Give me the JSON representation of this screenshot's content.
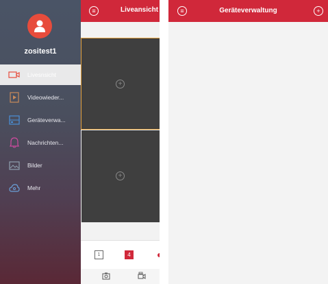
{
  "sidebar": {
    "username": "zositest1",
    "items": [
      {
        "label": "Livesnsicht",
        "icon": "camera-icon",
        "active": true
      },
      {
        "label": "Videowieder...",
        "icon": "video-playback-icon",
        "active": false
      },
      {
        "label": "Geräteverwa...",
        "icon": "device-icon",
        "active": false
      },
      {
        "label": "Nachrichten...",
        "icon": "bell-icon",
        "active": false
      },
      {
        "label": "Bilder",
        "icon": "image-icon",
        "active": false
      },
      {
        "label": "Mehr",
        "icon": "more-cloud-icon",
        "active": false
      }
    ]
  },
  "live_panel": {
    "title": "Liveansicht",
    "layout_one_label": "1",
    "layout_four_label": "4"
  },
  "device_screen": {
    "title": "Geräteverwaltung"
  },
  "colors": {
    "accent": "#d0283a",
    "avatar": "#e74c3c",
    "selected_tile_border": "#e6a23c"
  }
}
